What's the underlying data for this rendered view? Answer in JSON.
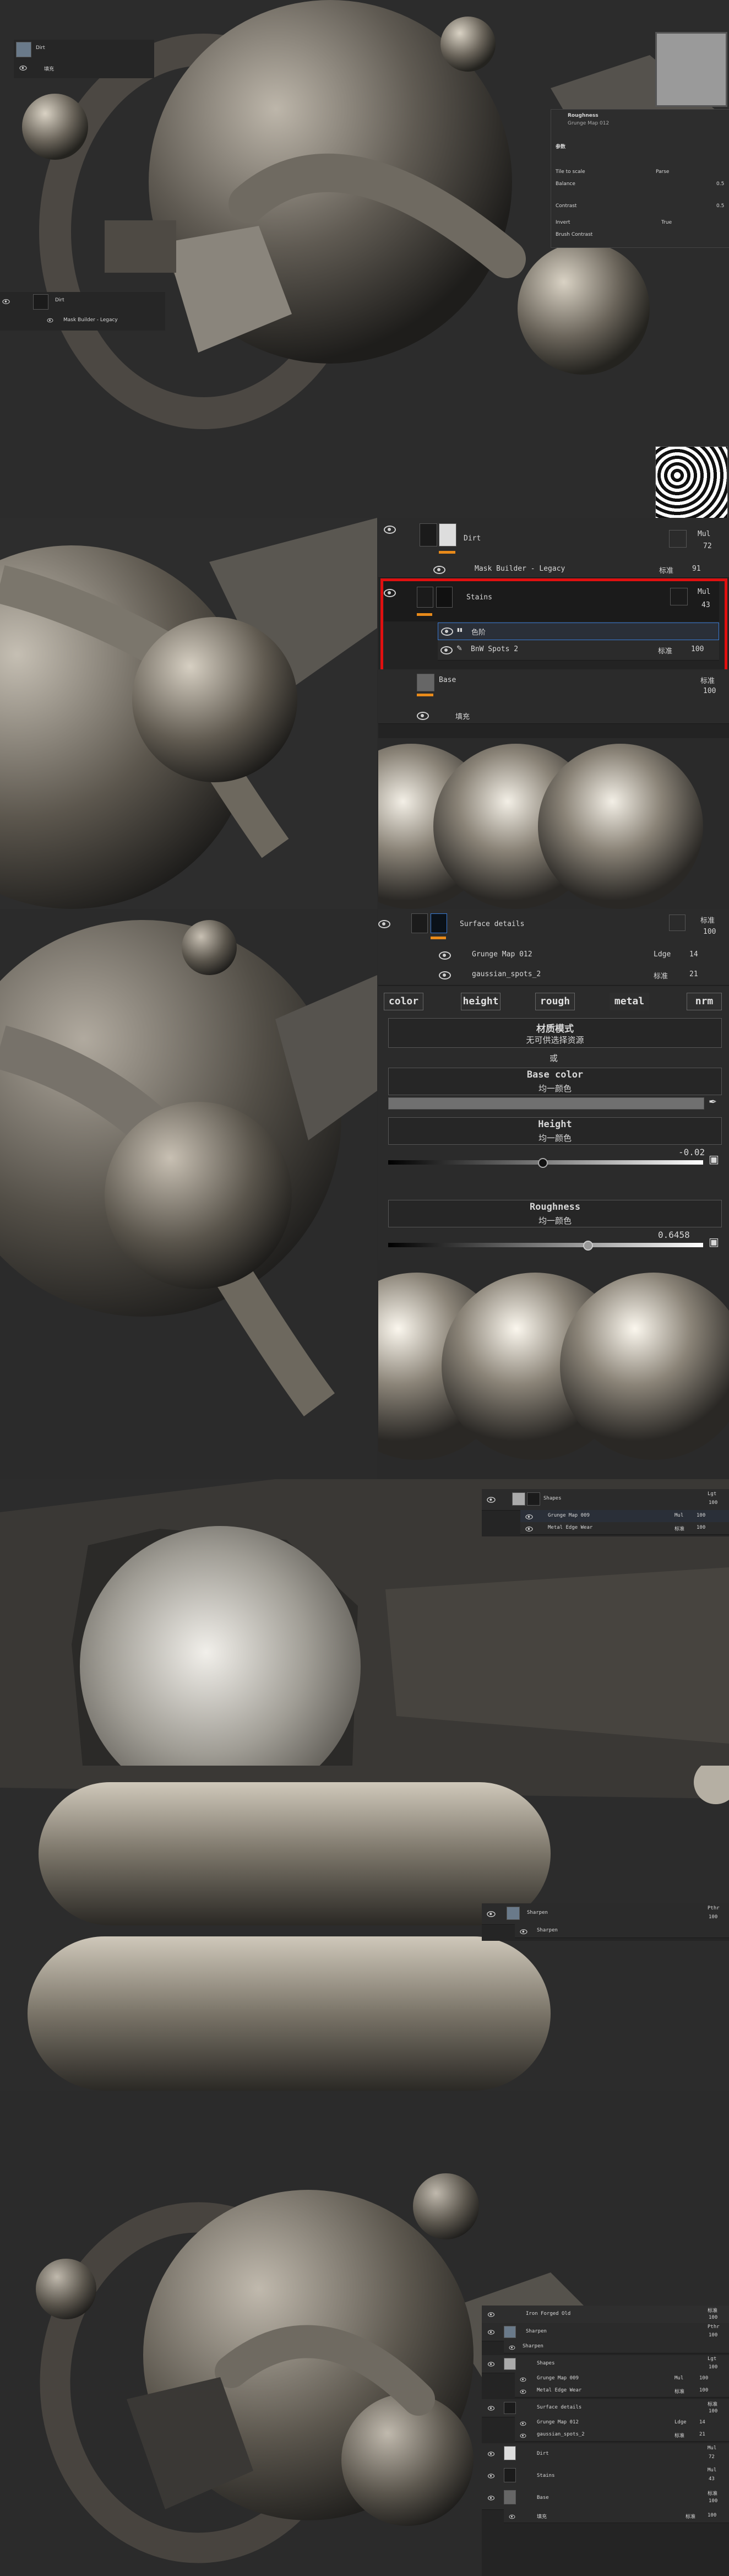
{
  "s1": {
    "layer_top": "Dirt",
    "layer_top_sub": "填充",
    "layer_mid": "Dirt",
    "layer_mid_sub": "Mask Builder - Legacy",
    "props": {
      "title": "Roughness",
      "subtitle": "Grunge Map 012",
      "section": "参数",
      "r1_label": "Tile to scale",
      "r1_value": "Parse",
      "r2_label": "Balance",
      "r2_value": "0.5",
      "r3_label": "Contrast",
      "r3_value": "0.5",
      "r4_label": "Invert",
      "r4_value": "True",
      "r5_label": "Brush Contrast"
    }
  },
  "s2": {
    "rows": [
      {
        "name": "Dirt",
        "blend": "Mul",
        "opacity": "72"
      },
      {
        "name": "Mask Builder - Legacy",
        "blend": "标准",
        "opacity": "91"
      },
      {
        "name": "Stains",
        "blend": "Mul",
        "opacity": "43"
      },
      {
        "name": "色阶",
        "blend": "",
        "opacity": ""
      },
      {
        "name": "BnW Spots 2",
        "blend": "标准",
        "opacity": "100"
      },
      {
        "name": "Base",
        "blend": "标准",
        "opacity": "100"
      },
      {
        "name": "填充",
        "blend": "",
        "opacity": ""
      }
    ]
  },
  "s3": {
    "layer": {
      "name": "Surface details",
      "blend": "标准",
      "opacity": "100"
    },
    "sub1": {
      "name": "Grunge Map 012",
      "blend": "Ldge",
      "opacity": "14"
    },
    "sub2": {
      "name": "gaussian_spots_2",
      "blend": "标准",
      "opacity": "21"
    },
    "channels": [
      "color",
      "height",
      "rough",
      "metal",
      "nrm"
    ],
    "material_mode_title": "材质模式",
    "material_mode_value": "无可供选择资源",
    "or_label": "或",
    "base_color_title": "Base color",
    "base_color_sub": "均一颜色",
    "height_title": "Height",
    "height_sub": "均一颜色",
    "height_value": "-0.02",
    "roughness_title": "Roughness",
    "roughness_sub": "均一颜色",
    "roughness_value": "0.6458"
  },
  "s4": {
    "layer": {
      "name": "Shapes",
      "blend": "Lgt",
      "opacity": "100"
    },
    "sub1": {
      "name": "Grunge Map 009",
      "blend": "Mul",
      "opacity": "100"
    },
    "sub2": {
      "name": "Metal Edge Wear",
      "blend": "标准",
      "opacity": "100"
    }
  },
  "s5": {
    "layer": {
      "name": "Sharpen",
      "blend": "Pthr",
      "opacity": "100"
    },
    "sub1": {
      "name": "Sharpen"
    }
  },
  "s6": {
    "rows": [
      {
        "name": "Iron Forged Old",
        "blend": "标准",
        "opacity": "100"
      },
      {
        "name": "Sharpen",
        "blend": "Pthr",
        "opacity": "100"
      },
      {
        "name": "Sharpen",
        "blend": "",
        "opacity": ""
      },
      {
        "name": "Shapes",
        "blend": "Lgt",
        "opacity": "100"
      },
      {
        "name": "Grunge Map 009",
        "blend": "Mul",
        "opacity": "100"
      },
      {
        "name": "Metal Edge Wear",
        "blend": "标准",
        "opacity": "100"
      },
      {
        "name": "Surface details",
        "blend": "标准",
        "opacity": "100"
      },
      {
        "name": "Grunge Map 012",
        "blend": "Ldge",
        "opacity": "14"
      },
      {
        "name": "gaussian_spots_2",
        "blend": "标准",
        "opacity": "21"
      },
      {
        "name": "Dirt",
        "blend": "Mul",
        "opacity": "72"
      },
      {
        "name": "Stains",
        "blend": "Mul",
        "opacity": "43"
      },
      {
        "name": "Base",
        "blend": "标准",
        "opacity": "100"
      },
      {
        "name": "填充",
        "blend": "标准",
        "opacity": "100"
      }
    ]
  },
  "colors": {
    "accent": "#e88a1a",
    "highlight": "#e01010",
    "selection": "#3a7bd5"
  }
}
